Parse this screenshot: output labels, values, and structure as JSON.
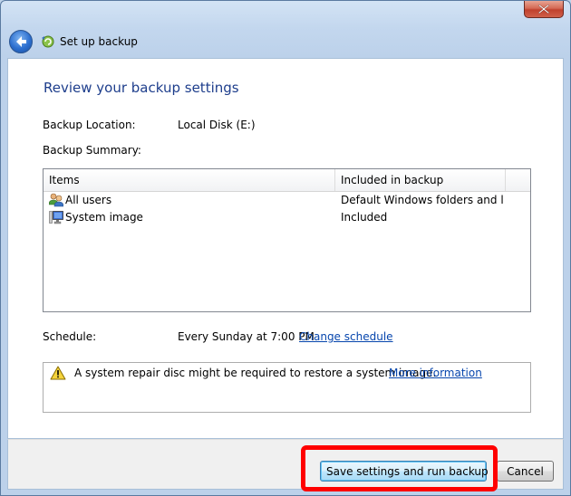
{
  "window": {
    "nav_title": "Set up backup"
  },
  "page": {
    "heading": "Review your backup settings",
    "backup_location_label": "Backup Location:",
    "backup_location_value": "Local Disk (E:)",
    "backup_summary_label": "Backup Summary:",
    "schedule_label": "Schedule:",
    "schedule_value": "Every Sunday at 7:00 PM",
    "change_schedule_link": "Change schedule"
  },
  "summary_table": {
    "columns": [
      "Items",
      "Included in backup"
    ],
    "rows": [
      {
        "item": "All users",
        "included": "Default Windows folders and lo...",
        "icon": "users-icon"
      },
      {
        "item": "System image",
        "included": "Included",
        "icon": "computer-icon"
      }
    ]
  },
  "notice": {
    "text": "A system repair disc might be required to restore a system image.",
    "link": "More information",
    "icon": "warning-icon"
  },
  "buttons": {
    "save_run": "Save settings and run backup",
    "cancel": "Cancel"
  },
  "colors": {
    "heading": "#1e3e8c",
    "link": "#0645ad",
    "highlight": "#ff0000"
  }
}
